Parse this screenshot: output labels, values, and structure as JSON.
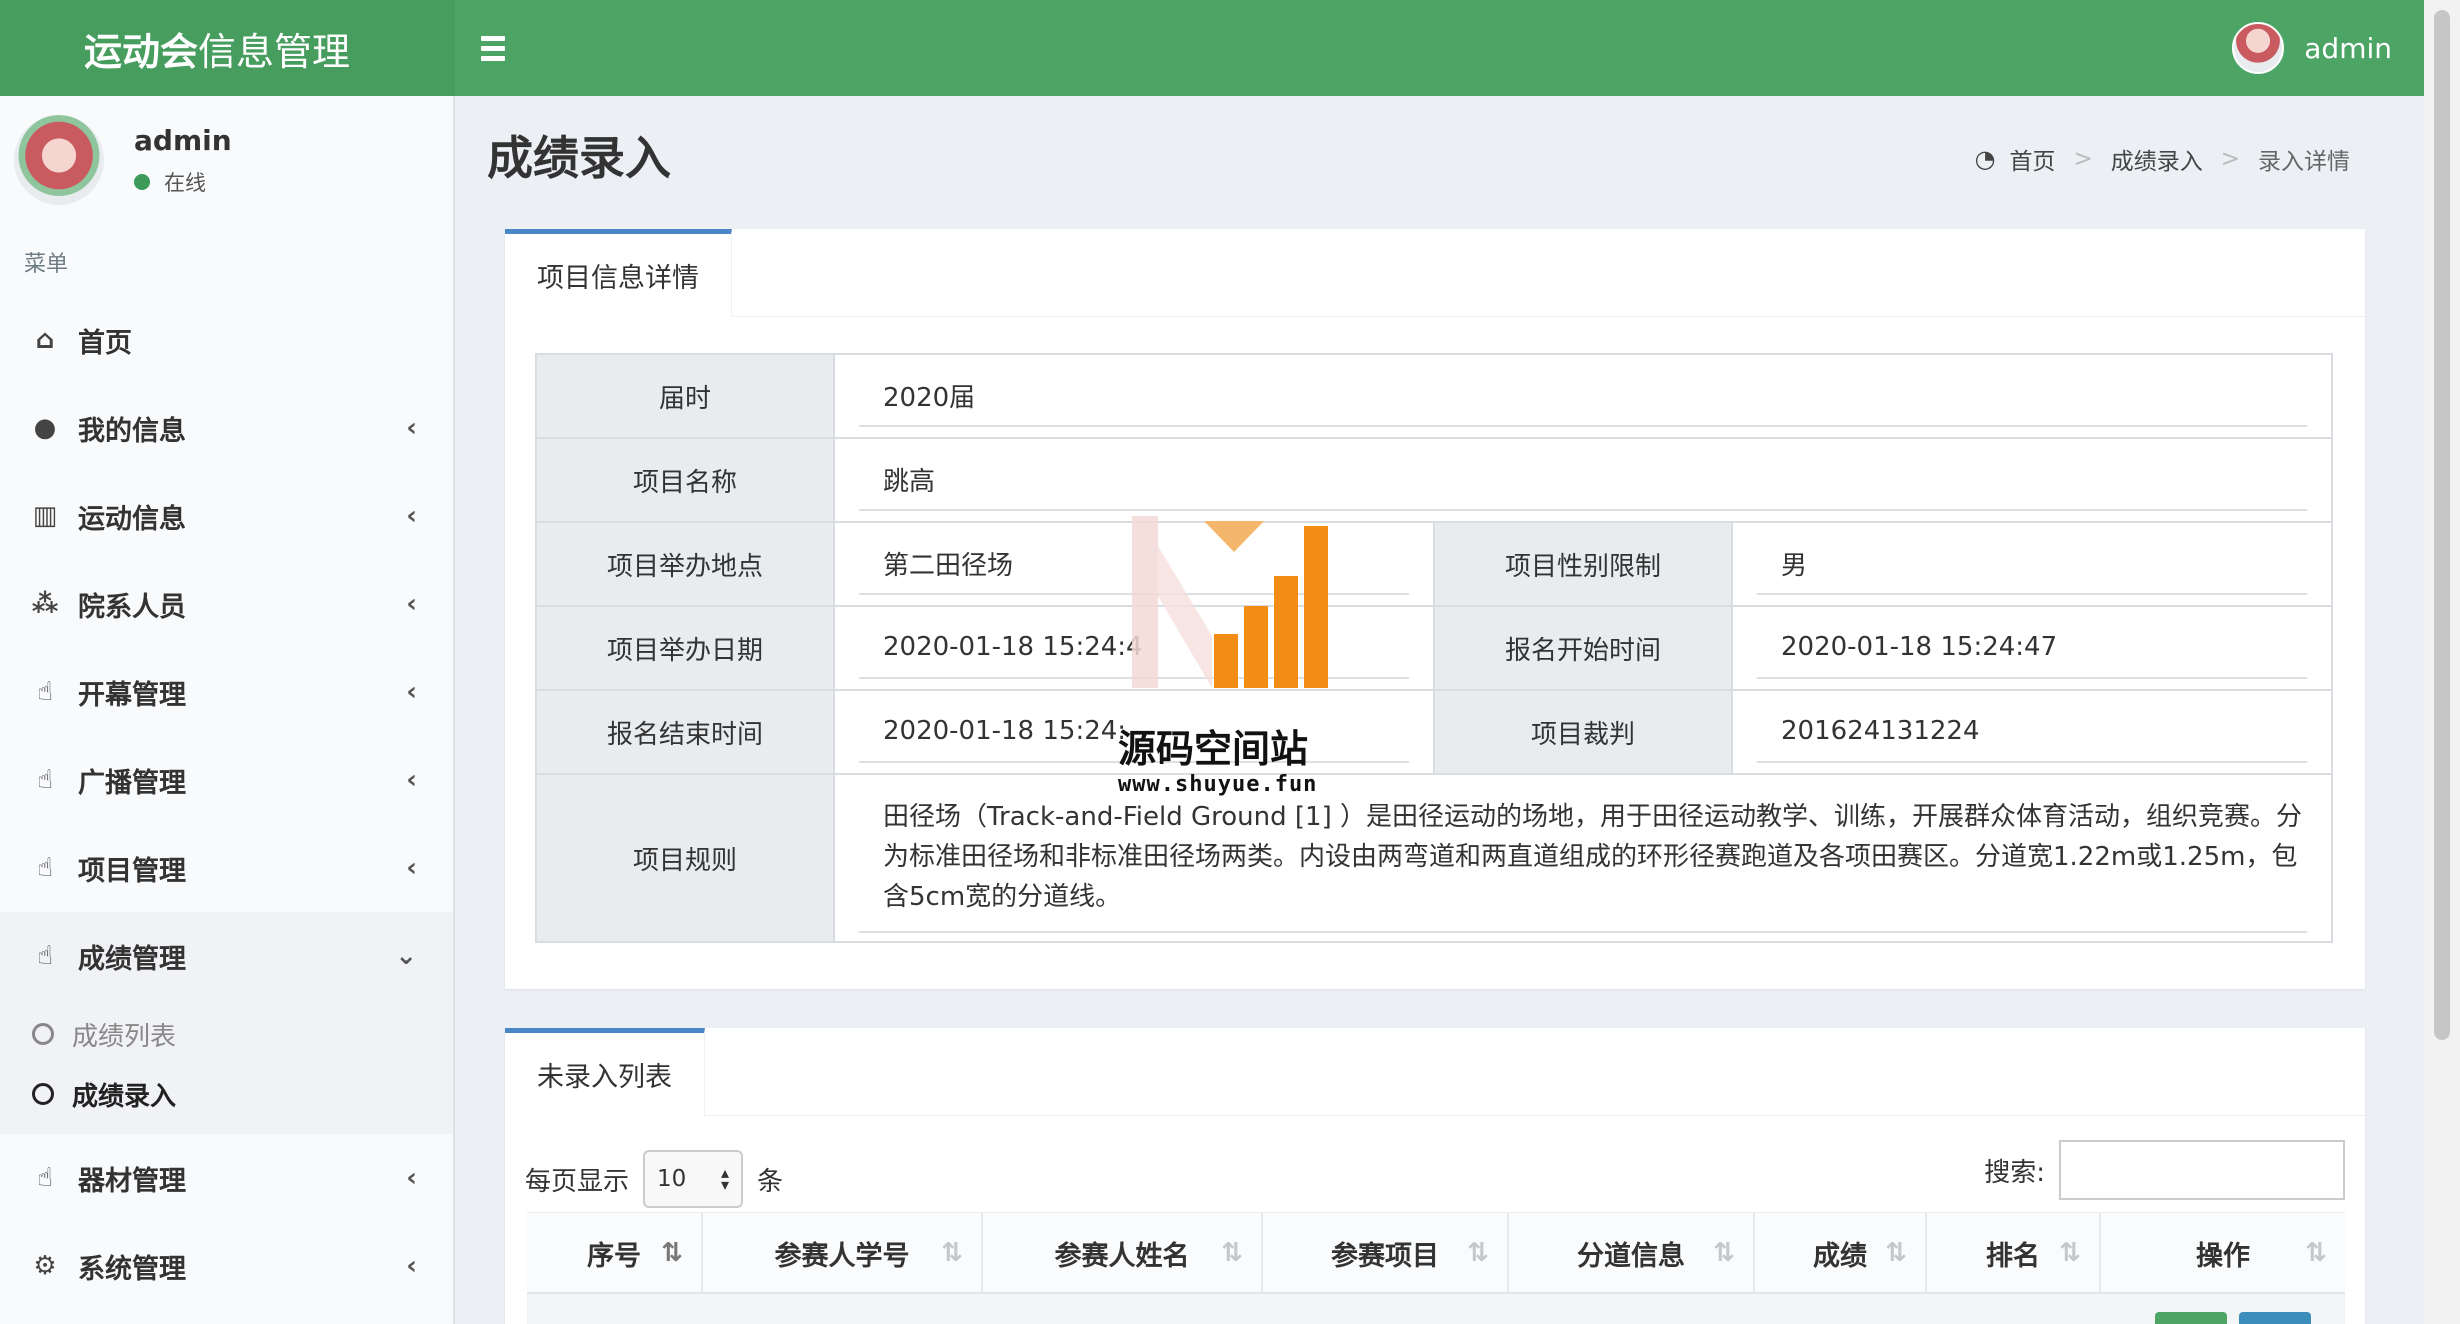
{
  "header": {
    "logo_bold": "运动会",
    "logo_rest": "信息管理",
    "user": "admin"
  },
  "sidebar": {
    "user_name": "admin",
    "user_status": "在线",
    "menu_header": "菜单",
    "items": [
      {
        "label": "首页",
        "icon": "home-icon"
      },
      {
        "label": "我的信息",
        "icon": "user-icon"
      },
      {
        "label": "运动信息",
        "icon": "bar-chart-icon"
      },
      {
        "label": "院系人员",
        "icon": "users-icon"
      },
      {
        "label": "开幕管理",
        "icon": "thumbs-up-icon"
      },
      {
        "label": "广播管理",
        "icon": "thumbs-up-icon"
      },
      {
        "label": "项目管理",
        "icon": "thumbs-up-icon"
      },
      {
        "label": "成绩管理",
        "icon": "thumbs-up-icon"
      },
      {
        "label": "器材管理",
        "icon": "thumbs-up-icon"
      },
      {
        "label": "系统管理",
        "icon": "gear-icon"
      }
    ],
    "sub_items": [
      {
        "label": "成绩列表"
      },
      {
        "label": "成绩录入"
      }
    ]
  },
  "page": {
    "title": "成绩录入",
    "breadcrumb": [
      "首页",
      "成绩录入",
      "录入详情"
    ]
  },
  "detail": {
    "tab": "项目信息详情",
    "session_label": "届时",
    "session": "2020届",
    "name_label": "项目名称",
    "name": "跳高",
    "place_label": "项目举办地点",
    "place": "第二田径场",
    "gender_label": "项目性别限制",
    "gender": "男",
    "date_label": "项目举办日期",
    "date": "2020-01-18 15:24:4",
    "signup_start_label": "报名开始时间",
    "signup_start": "2020-01-18 15:24:47",
    "signup_end_label": "报名结束时间",
    "signup_end": "2020-01-18 15:24:",
    "judge_label": "项目裁判",
    "judge": "201624131224",
    "rule_label": "项目规则",
    "rule": "田径场（Track-and-Field Ground [1] ）是田径运动的场地，用于田径运动教学、训练，开展群众体育活动，组织竞赛。分为标准田径场和非标准田径场两类。内设由两弯道和两直道组成的环形径赛跑道及各项田赛区。分道宽1.22m或1.25m，包含5cm宽的分道线。"
  },
  "list": {
    "tab": "未录入列表",
    "per_page_label": "每页显示",
    "per_page_value": "10",
    "per_page_unit": "条",
    "search_label": "搜索:",
    "columns": [
      "序号",
      "参赛人学号",
      "参赛人姓名",
      "参赛项目",
      "分道信息",
      "成绩",
      "排名",
      "操作"
    ]
  },
  "watermark": {
    "text": "源码空间站",
    "url": "www.shuyue.fun"
  },
  "colors": {
    "header": "#4ca565",
    "tab_accent": "#4a87c8",
    "watermark_orange": "#f28c14"
  }
}
